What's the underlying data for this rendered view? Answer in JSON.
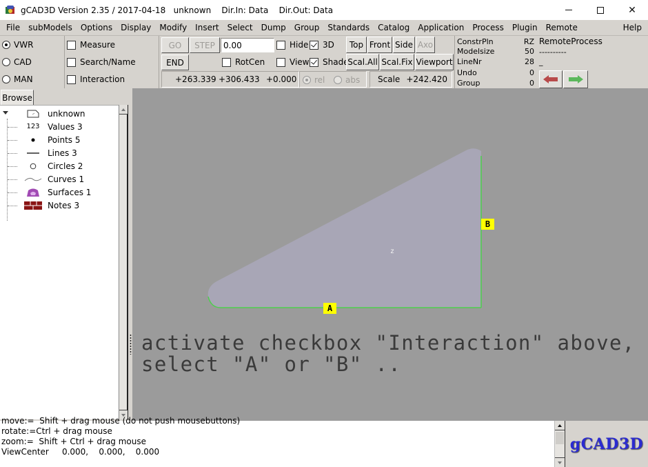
{
  "window": {
    "title": "gCAD3D Version 2.35 / 2017-04-18   unknown    Dir.In: Data    Dir.Out: Data",
    "controls": {
      "minimize": "minimize",
      "maximize": "maximize",
      "close": "✕"
    }
  },
  "menu": {
    "items": [
      "File",
      "subModels",
      "Options",
      "Display",
      "Modify",
      "Insert",
      "Select",
      "Dump",
      "Group",
      "Standards",
      "Catalog",
      "Application",
      "Process",
      "Plugin",
      "Remote"
    ],
    "help": "Help"
  },
  "toolbar": {
    "modes": [
      {
        "label": "VWR",
        "selected": true
      },
      {
        "label": "CAD",
        "selected": false
      },
      {
        "label": "MAN",
        "selected": false
      }
    ],
    "checks_left": [
      {
        "label": "Measure",
        "checked": false
      },
      {
        "label": "Search/Name",
        "checked": false
      },
      {
        "label": "Interaction",
        "checked": false
      }
    ],
    "go_label": "GO",
    "step_label": "STEP",
    "end_label": "END",
    "step_value": "0.00",
    "hide": {
      "label": "Hide",
      "checked": false
    },
    "three_d": {
      "label": "3D",
      "checked": true
    },
    "rotcen": {
      "label": "RotCen",
      "checked": false
    },
    "view": {
      "label": "View",
      "checked": false
    },
    "shade": {
      "label": "Shade",
      "checked": true
    },
    "view_buttons": {
      "top": "Top",
      "front": "Front",
      "side": "Side",
      "axo": "Axo",
      "scal_all": "Scal.All",
      "scal_fix": "Scal.Fix",
      "viewport": "Viewport"
    },
    "coords": {
      "x": "+263.339",
      "y": "+306.433",
      "z": "+0.000"
    },
    "rel": {
      "label": "rel",
      "selected": true
    },
    "abs": {
      "label": "abs",
      "selected": false
    },
    "scale_label": "Scale",
    "scale_value": "+242.420"
  },
  "info": {
    "rows": [
      {
        "label": "ConstrPln",
        "value": "RZ"
      },
      {
        "label": "Modelsize",
        "value": "50"
      },
      {
        "label": "LineNr",
        "value": "28"
      },
      {
        "label": "Undo",
        "value": "0"
      },
      {
        "label": "Group",
        "value": "0"
      }
    ],
    "remote_process": "RemoteProcess",
    "remote_line2": "----------",
    "remote_line3": "_",
    "back_arrow_color": "#b84a4a",
    "forward_arrow_color": "#5cb85c"
  },
  "browser": {
    "tab": "Browse",
    "root": "unknown",
    "items": [
      {
        "icon": "123",
        "label": "Values 3"
      },
      {
        "icon": "point",
        "label": "Points 5"
      },
      {
        "icon": "line",
        "label": "Lines 3"
      },
      {
        "icon": "circle",
        "label": "Circles 2"
      },
      {
        "icon": "curve",
        "label": "Curves 1"
      },
      {
        "icon": "surface",
        "label": "Surfaces 1"
      },
      {
        "icon": "notes",
        "label": "Notes 3"
      }
    ]
  },
  "viewport": {
    "background": "#9b9b9b",
    "surface_color": "#a8a6b6",
    "edge_color": "#4cd04c",
    "label_a": "A",
    "label_b": "B",
    "axis_label": "z",
    "message_line1": "activate checkbox \"Interaction\" above,",
    "message_line2": "select \"A\" or \"B\" .."
  },
  "messages": {
    "lines": [
      "move:=  Shift + drag mouse (do not push mousebuttons)",
      "rotate:=Ctrl + drag mouse",
      "zoom:=  Shift + Ctrl + drag mouse",
      "ViewCenter     0.000,    0.000,    0.000"
    ]
  },
  "logo": "gCAD3D"
}
